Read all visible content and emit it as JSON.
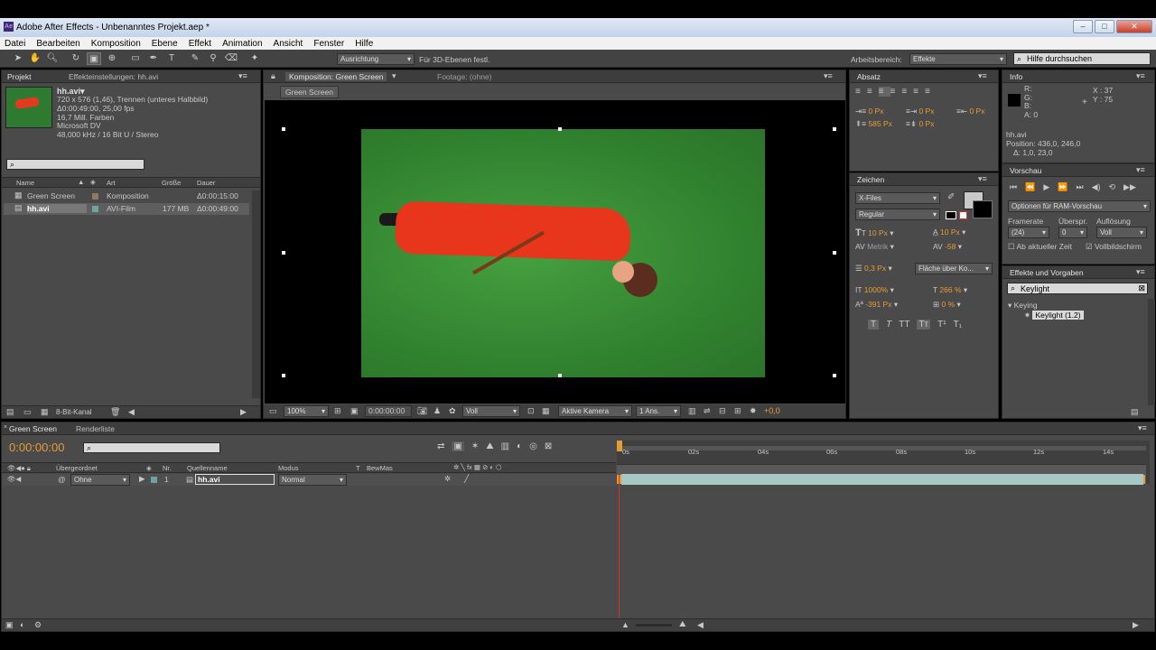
{
  "window": {
    "title": "Adobe After Effects - Unbenanntes Projekt.aep *",
    "buttons": [
      "–",
      "□",
      "✕"
    ]
  },
  "menu": [
    "Datei",
    "Bearbeiten",
    "Komposition",
    "Ebene",
    "Effekt",
    "Animation",
    "Ansicht",
    "Fenster",
    "Hilfe"
  ],
  "toolbar": {
    "align_label": "Ausrichtung",
    "threed_label": "Für 3D-Ebenen festl.",
    "workspace_label": "Arbeitsbereich:",
    "workspace_value": "Effekte",
    "help_placeholder": "Hilfe durchsuchen"
  },
  "project": {
    "tabs": [
      "Projekt",
      "Effekteinstellungen: hh.avi"
    ],
    "footage_name": "hh.avi▾",
    "info": [
      "720 x 576 (1,46), Trennen (unteres Halbbild)",
      "Δ0:00:49:00, 25,00 fps",
      "16,7 Mill. Farben",
      "Microsoft DV",
      "48,000 kHz / 16 Bit U / Stereo"
    ],
    "columns": {
      "name": "Name",
      "type": "Art",
      "size": "Größe",
      "duration": "Dauer"
    },
    "items": [
      {
        "name": "Green Screen",
        "type": "Komposition",
        "size": "",
        "duration": "Δ0:00:15:00",
        "color": "#8e7a63"
      },
      {
        "name": "hh.avi",
        "type": "AVI-Film",
        "size": "177 MB",
        "duration": "Δ0:00:49:00",
        "color": "#6fa3a3"
      }
    ],
    "bitdepth": "8-Bit-Kanal"
  },
  "composition": {
    "tabs": [
      "Komposition: Green Screen",
      "Footage: (ohne)"
    ],
    "breadcrumb": "Green Screen",
    "zoom": "100%",
    "timecode": "0:00:00:00",
    "resolution": "Voll",
    "camera": "Aktive Kamera",
    "views": "1 Ans.",
    "exposure": "+0,0"
  },
  "absatz": {
    "title": "Absatz",
    "values": [
      "0 Px",
      "0 Px",
      "0 Px",
      "585 Px",
      "0 Px"
    ]
  },
  "zeichen": {
    "title": "Zeichen",
    "font": "X-Files",
    "style": "Regular",
    "size": "10 Px",
    "leading": "10 Px",
    "kerning": "Metrik",
    "tracking": "-58",
    "stroke": "0,3 Px",
    "stroke_mode": "Fläche über Ko...",
    "vscale": "1000%",
    "hscale": "266 %",
    "baseline": "-391 Px",
    "tsume": "0 %",
    "styles": [
      "T",
      "T",
      "TT",
      "Tт",
      "T¹",
      "T₁"
    ]
  },
  "info": {
    "title": "Info",
    "channels": [
      "R:",
      "G:",
      "B:",
      "A: 0"
    ],
    "coords": [
      "X : 37",
      "Y : 75"
    ],
    "layer": "hh.avi",
    "position": "Position: 436,0, 246,0",
    "delta": "Δ: 1,0, 23,0"
  },
  "preview": {
    "title": "Vorschau",
    "options": "Optionen für RAM-Vorschau",
    "labels": [
      "Framerate",
      "Überspr.",
      "Auflösung"
    ],
    "values": [
      "(24)",
      "0",
      "Voll"
    ],
    "from_current": "Ab aktueller Zeit",
    "fullscreen": "Vollbildschirm"
  },
  "effects": {
    "title": "Effekte und Vorgaben",
    "search": "Keylight",
    "category": "Keying",
    "item": "Keylight (1.2)"
  },
  "timeline": {
    "tabs": [
      "Green Screen",
      "Renderliste"
    ],
    "timecode": "0:00:00:00",
    "columns": [
      "Übergeordnet",
      "Nr.",
      "Quellenname",
      "Modus",
      "T",
      "BewMas"
    ],
    "layer": {
      "parent": "Ohne",
      "num": "1",
      "name": "hh.avi",
      "mode": "Normal"
    },
    "ruler": [
      "0s",
      "02s",
      "04s",
      "06s",
      "08s",
      "10s",
      "12s",
      "14s"
    ]
  },
  "colors": {
    "accent_orange": "#e69c34",
    "green_screen": "#3f8f3a",
    "layer_bar": "#a7c9c4"
  }
}
